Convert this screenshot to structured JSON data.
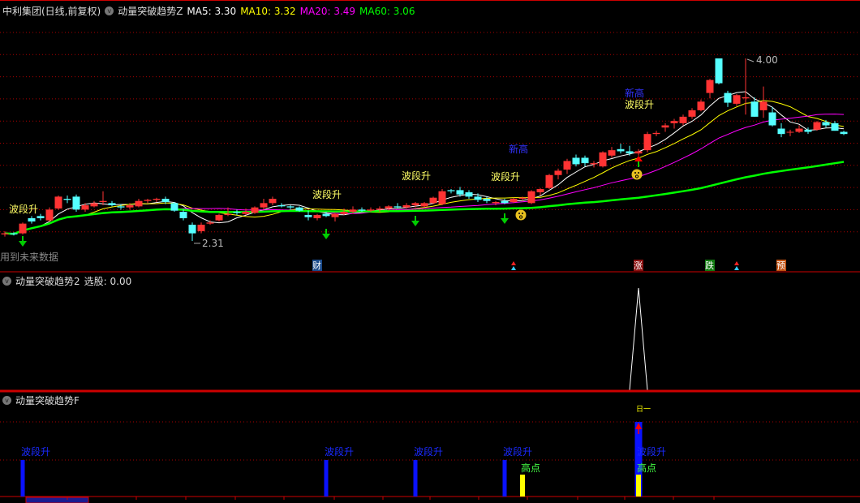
{
  "header": {
    "stock": "中利集团(日线,前复权)",
    "indicator": "动量突破趋势Z",
    "ma": [
      {
        "label": "MA5: 3.30",
        "color": "#ffffff"
      },
      {
        "label": "MA10: 3.32",
        "color": "#ffff00"
      },
      {
        "label": "MA20: 3.49",
        "color": "#ff00ff"
      },
      {
        "label": "MA60: 3.06",
        "color": "#00ff00"
      }
    ]
  },
  "future_data_note": "用到未来数据",
  "panel2": {
    "title": "动量突破趋势2",
    "value_label": "选股: 0.00"
  },
  "panel3": {
    "title": "动量突破趋势F",
    "mark_label": "日一"
  },
  "colors": {
    "up": "#ff3333",
    "down": "#55ffff",
    "ma5": "#ffffff",
    "ma10": "#ffff00",
    "ma20": "#ff00ff",
    "ma60": "#00ff00",
    "grid": "#aa0000"
  },
  "chart_data": {
    "type": "candlestick",
    "ohlc_format": [
      "open",
      "high",
      "low",
      "close"
    ],
    "candles": [
      [
        2.37,
        2.4,
        2.35,
        2.38
      ],
      [
        2.38,
        2.39,
        2.36,
        2.37
      ],
      [
        2.38,
        2.48,
        2.37,
        2.47
      ],
      [
        2.52,
        2.54,
        2.47,
        2.49
      ],
      [
        2.54,
        2.56,
        2.5,
        2.52
      ],
      [
        2.5,
        2.62,
        2.49,
        2.6
      ],
      [
        2.61,
        2.73,
        2.6,
        2.72
      ],
      [
        2.7,
        2.73,
        2.66,
        2.69
      ],
      [
        2.72,
        2.74,
        2.58,
        2.6
      ],
      [
        2.6,
        2.66,
        2.58,
        2.64
      ],
      [
        2.63,
        2.68,
        2.62,
        2.66
      ],
      [
        2.67,
        2.77,
        2.64,
        2.68
      ],
      [
        2.66,
        2.68,
        2.63,
        2.64
      ],
      [
        2.63,
        2.65,
        2.6,
        2.62
      ],
      [
        2.62,
        2.66,
        2.6,
        2.64
      ],
      [
        2.63,
        2.7,
        2.62,
        2.68
      ],
      [
        2.68,
        2.7,
        2.66,
        2.69
      ],
      [
        2.69,
        2.71,
        2.67,
        2.7
      ],
      [
        2.7,
        2.72,
        2.65,
        2.67
      ],
      [
        2.66,
        2.67,
        2.58,
        2.59
      ],
      [
        2.58,
        2.6,
        2.5,
        2.52
      ],
      [
        2.46,
        2.48,
        2.31,
        2.38
      ],
      [
        2.4,
        2.48,
        2.38,
        2.46
      ],
      [
        2.47,
        2.5,
        2.46,
        2.48
      ],
      [
        2.5,
        2.56,
        2.49,
        2.55
      ],
      [
        2.55,
        2.62,
        2.54,
        2.56
      ],
      [
        2.58,
        2.6,
        2.55,
        2.57
      ],
      [
        2.56,
        2.61,
        2.55,
        2.58
      ],
      [
        2.57,
        2.63,
        2.56,
        2.62
      ],
      [
        2.62,
        2.7,
        2.6,
        2.66
      ],
      [
        2.66,
        2.72,
        2.64,
        2.7
      ],
      [
        2.64,
        2.66,
        2.62,
        2.63
      ],
      [
        2.63,
        2.64,
        2.6,
        2.62
      ],
      [
        2.62,
        2.63,
        2.58,
        2.59
      ],
      [
        2.55,
        2.59,
        2.5,
        2.53
      ],
      [
        2.52,
        2.56,
        2.5,
        2.55
      ],
      [
        2.56,
        2.58,
        2.53,
        2.54
      ],
      [
        2.53,
        2.57,
        2.49,
        2.56
      ],
      [
        2.56,
        2.61,
        2.55,
        2.58
      ],
      [
        2.58,
        2.63,
        2.56,
        2.6
      ],
      [
        2.6,
        2.62,
        2.58,
        2.59
      ],
      [
        2.59,
        2.62,
        2.58,
        2.6
      ],
      [
        2.6,
        2.63,
        2.58,
        2.61
      ],
      [
        2.61,
        2.64,
        2.59,
        2.63
      ],
      [
        2.63,
        2.66,
        2.61,
        2.62
      ],
      [
        2.62,
        2.66,
        2.61,
        2.64
      ],
      [
        2.64,
        2.67,
        2.62,
        2.66
      ],
      [
        2.63,
        2.67,
        2.62,
        2.66
      ],
      [
        2.66,
        2.72,
        2.65,
        2.71
      ],
      [
        2.65,
        2.79,
        2.64,
        2.77
      ],
      [
        2.78,
        2.79,
        2.75,
        2.77
      ],
      [
        2.78,
        2.81,
        2.72,
        2.74
      ],
      [
        2.76,
        2.78,
        2.7,
        2.72
      ],
      [
        2.72,
        2.75,
        2.67,
        2.69
      ],
      [
        2.7,
        2.72,
        2.66,
        2.68
      ],
      [
        2.66,
        2.68,
        2.64,
        2.67
      ],
      [
        2.68,
        2.7,
        2.65,
        2.66
      ],
      [
        2.67,
        2.71,
        2.66,
        2.7
      ],
      [
        2.7,
        2.72,
        2.68,
        2.71
      ],
      [
        2.66,
        2.78,
        2.65,
        2.77
      ],
      [
        2.76,
        2.8,
        2.73,
        2.79
      ],
      [
        2.8,
        2.93,
        2.79,
        2.92
      ],
      [
        2.92,
        2.98,
        2.88,
        2.96
      ],
      [
        2.97,
        3.07,
        2.93,
        3.05
      ],
      [
        3.08,
        3.11,
        3.0,
        3.02
      ],
      [
        3.08,
        3.1,
        3.0,
        3.03
      ],
      [
        3.02,
        3.05,
        2.99,
        3.03
      ],
      [
        3.0,
        3.14,
        2.99,
        3.13
      ],
      [
        3.1,
        3.18,
        3.08,
        3.15
      ],
      [
        3.16,
        3.21,
        3.12,
        3.14
      ],
      [
        3.14,
        3.19,
        3.1,
        3.12
      ],
      [
        3.12,
        3.16,
        3.1,
        3.14
      ],
      [
        3.15,
        3.32,
        3.13,
        3.3
      ],
      [
        3.3,
        3.33,
        3.28,
        3.31
      ],
      [
        3.36,
        3.4,
        3.32,
        3.38
      ],
      [
        3.4,
        3.44,
        3.35,
        3.42
      ],
      [
        3.4,
        3.48,
        3.38,
        3.46
      ],
      [
        3.46,
        3.54,
        3.44,
        3.52
      ],
      [
        3.52,
        3.62,
        3.51,
        3.6
      ],
      [
        3.68,
        3.81,
        3.63,
        3.8
      ],
      [
        4.0,
        4.0,
        3.76,
        3.77
      ],
      [
        3.68,
        3.7,
        3.55,
        3.59
      ],
      [
        3.58,
        3.67,
        3.56,
        3.66
      ],
      [
        3.63,
        4.0,
        3.48,
        3.64
      ],
      [
        3.6,
        3.64,
        3.46,
        3.46
      ],
      [
        3.52,
        3.74,
        3.45,
        3.6
      ],
      [
        3.5,
        3.55,
        3.37,
        3.38
      ],
      [
        3.35,
        3.4,
        3.27,
        3.3
      ],
      [
        3.32,
        3.34,
        3.28,
        3.32
      ],
      [
        3.32,
        3.38,
        3.31,
        3.35
      ],
      [
        3.34,
        3.36,
        3.3,
        3.32
      ],
      [
        3.34,
        3.42,
        3.33,
        3.41
      ],
      [
        3.41,
        3.43,
        3.36,
        3.38
      ],
      [
        3.4,
        3.42,
        3.33,
        3.33
      ],
      [
        3.32,
        3.33,
        3.29,
        3.3
      ]
    ],
    "price_range": [
      2.2,
      4.25
    ],
    "max_label": {
      "index": 83,
      "text": "4.00"
    },
    "min_label": {
      "index": 21,
      "text": "2.31"
    },
    "moving_averages": [
      5,
      10,
      20,
      60
    ],
    "grid": true,
    "signals": [
      {
        "index": 2,
        "text": "波段升",
        "color": "#ffff66"
      },
      {
        "index": 36,
        "text": "波段升",
        "color": "#ffff66"
      },
      {
        "index": 46,
        "text": "波段升",
        "color": "#ffff66"
      },
      {
        "index": 56,
        "text": "波段升",
        "color": "#ffff66"
      },
      {
        "index": 71,
        "text": "波段升",
        "color": "#ffff66"
      },
      {
        "index": 58,
        "text": "新高",
        "color": "#3333ff"
      },
      {
        "index": 71,
        "text": "新高",
        "color": "#3333ff"
      }
    ],
    "down_arrows": [
      2,
      36,
      46,
      56
    ],
    "smileys": [
      58,
      71
    ],
    "up_arrows": [
      71
    ],
    "event_markers": [
      {
        "index": 35,
        "text": "财",
        "bg": "#1a4a8a"
      },
      {
        "index": 57,
        "text": "",
        "bg": "triangle"
      },
      {
        "index": 71,
        "text": "涨",
        "bg": "#8a1010"
      },
      {
        "index": 79,
        "text": "跌",
        "bg": "#107a10"
      },
      {
        "index": 82,
        "text": "",
        "bg": "triangle"
      },
      {
        "index": 87,
        "text": "预",
        "bg": "#c05010"
      }
    ],
    "panel2_series": {
      "spike_index": 71,
      "spike_value": 1,
      "baseline": 0
    },
    "panel3_bars": [
      {
        "index": 2,
        "label": "波段升",
        "level": 1
      },
      {
        "index": 36,
        "label": "波段升",
        "level": 1
      },
      {
        "index": 46,
        "label": "波段升",
        "level": 1
      },
      {
        "index": 56,
        "label": "波段升",
        "level": 1
      },
      {
        "index": 71,
        "label": "波段升",
        "level": 2
      }
    ],
    "panel3_high_points": [
      {
        "index": 58,
        "label": "高点"
      },
      {
        "index": 71,
        "label": "高点"
      }
    ]
  }
}
